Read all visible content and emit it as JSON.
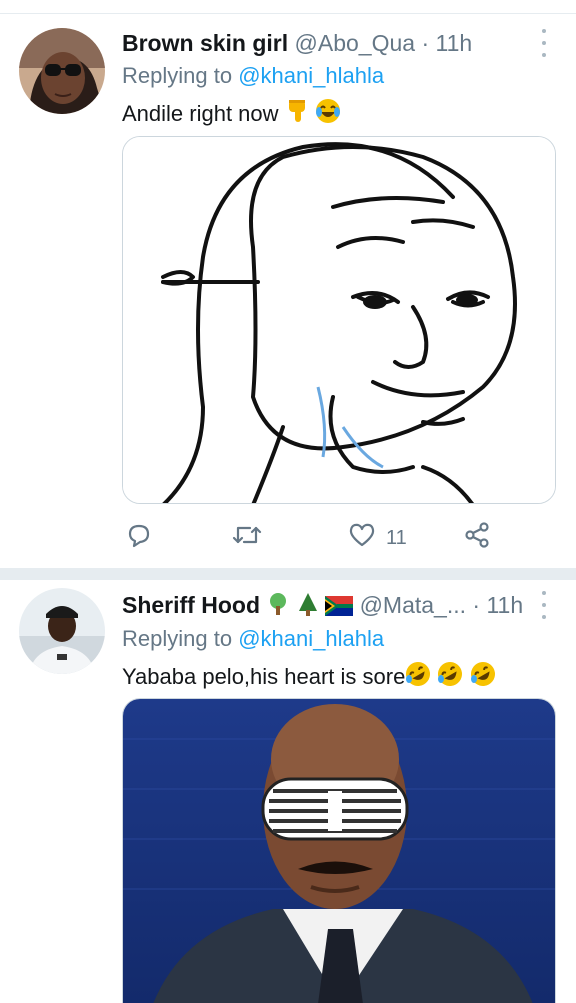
{
  "tweets": [
    {
      "name": "Brown skin girl",
      "handle": "@Abo_Qua",
      "dot": "·",
      "time": "11h",
      "replying_prefix": "Replying to ",
      "replying_to": "@khani_hlahla",
      "text": "Andile right now",
      "text_emojis": [
        "backhand-index-pointing-down",
        "face-with-tears-of-joy"
      ],
      "media": "wojak-mask-meme",
      "actions": {
        "reply_icon": "reply-icon",
        "retweet_icon": "retweet-icon",
        "like_icon": "heart-icon",
        "like_count": "11",
        "share_icon": "share-icon"
      }
    },
    {
      "name": "Sheriff Hood",
      "name_emojis": [
        "deciduous-tree",
        "evergreen-tree",
        "flag-south-africa"
      ],
      "handle": "@Mata_...",
      "dot": "·",
      "time": "11h",
      "replying_prefix": "Replying to ",
      "replying_to": "@khani_hlahla",
      "text": "Yababa pelo,his heart is sore",
      "text_emojis": [
        "rolling-on-floor-laughing",
        "rolling-on-floor-laughing",
        "rolling-on-floor-laughing"
      ],
      "media": "man-with-shutter-shades-photo"
    }
  ],
  "colors": {
    "link": "#1da1f2",
    "secondary_text": "#657786",
    "divider": "#e6ecf0"
  }
}
